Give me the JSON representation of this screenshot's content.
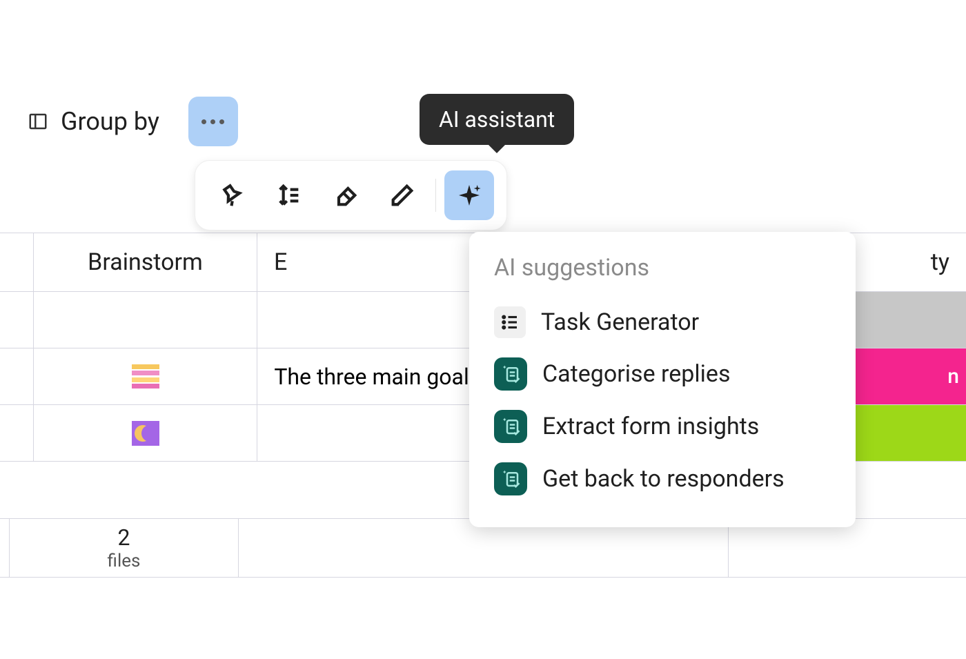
{
  "toolbar_header": {
    "group_by_label": "Group by"
  },
  "tooltip": {
    "text": "AI assistant"
  },
  "dropdown": {
    "header": "AI suggestions",
    "items": [
      {
        "label": "Task Generator",
        "icon": "list"
      },
      {
        "label": "Categorise replies",
        "icon": "teal"
      },
      {
        "label": "Extract form insights",
        "icon": "teal"
      },
      {
        "label": "Get back to responders",
        "icon": "teal"
      }
    ]
  },
  "table": {
    "headers": {
      "col_b": "Brainstorm",
      "col_c_partial": "E",
      "col_d_partial": "ty"
    },
    "rows": [
      {
        "icon": "stripes",
        "text": "The three main goals o",
        "tag_partial": "n",
        "tag_color": "#f4248e"
      },
      {
        "icon": "moon",
        "text": "",
        "tag_partial": "",
        "tag_color": "#9dd818"
      }
    ],
    "summary": {
      "count": "2",
      "label": "files"
    }
  }
}
